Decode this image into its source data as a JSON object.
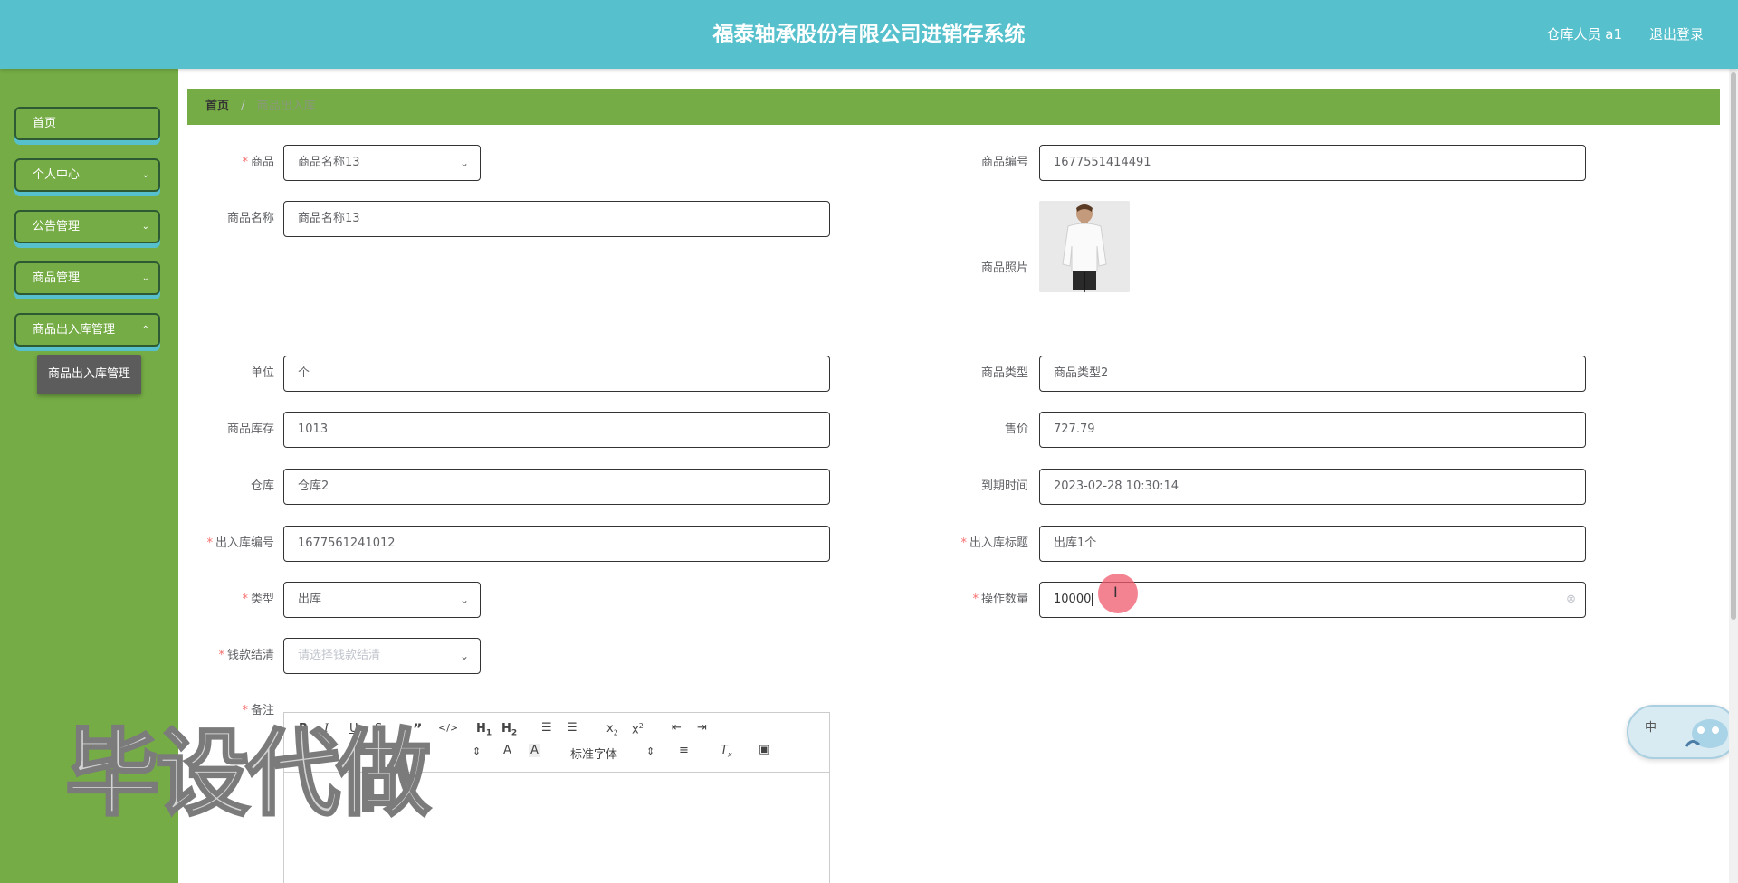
{
  "header": {
    "title": "福泰轴承股份有限公司进销存系统",
    "user": "仓库人员 a1",
    "logout": "退出登录"
  },
  "sidebar": {
    "items": [
      {
        "label": "首页"
      },
      {
        "label": "个人中心",
        "expandable": true
      },
      {
        "label": "公告管理",
        "expandable": true
      },
      {
        "label": "商品管理",
        "expandable": true
      },
      {
        "label": "商品出入库管理",
        "expandable": true
      }
    ],
    "submenu": "商品出入库管理"
  },
  "breadcrumb": {
    "home": "首页",
    "separator": "/",
    "current": "商品出入库"
  },
  "form": {
    "product": {
      "label": "商品",
      "required": true,
      "value": "商品名称13"
    },
    "product_code": {
      "label": "商品编号",
      "value": "1677551414491"
    },
    "product_name": {
      "label": "商品名称",
      "value": "商品名称13"
    },
    "product_photo": {
      "label": "商品照片"
    },
    "unit": {
      "label": "单位",
      "value": "个"
    },
    "product_type": {
      "label": "商品类型",
      "value": "商品类型2"
    },
    "stock": {
      "label": "商品库存",
      "value": "1013"
    },
    "price": {
      "label": "售价",
      "value": "727.79"
    },
    "warehouse": {
      "label": "仓库",
      "value": "仓库2"
    },
    "expire_time": {
      "label": "到期时间",
      "value": "2023-02-28 10:30:14"
    },
    "io_number": {
      "label": "出入库编号",
      "required": true,
      "value": "1677561241012"
    },
    "io_title": {
      "label": "出入库标题",
      "required": true,
      "value": "出库1个"
    },
    "type": {
      "label": "类型",
      "required": true,
      "value": "出库"
    },
    "quantity": {
      "label": "操作数量",
      "required": true,
      "value": "10000"
    },
    "payment": {
      "label": "钱款结清",
      "required": true,
      "placeholder": "请选择钱款结清"
    },
    "remark": {
      "label": "备注",
      "required": true
    }
  },
  "editor": {
    "font_family": "标准字体",
    "tools": [
      "bold-icon",
      "italic-icon",
      "underline-icon",
      "strike-icon",
      "blockquote-icon",
      "code-icon",
      "h1-icon",
      "h2-icon",
      "ordered-list-icon",
      "bullet-list-icon",
      "subscript-icon",
      "superscript-icon",
      "outdent-icon",
      "indent-icon",
      "font-color-icon",
      "background-color-icon",
      "align-icon",
      "clear-format-icon",
      "image-icon"
    ]
  },
  "ime": {
    "label": "中"
  },
  "watermark": "毕设代做",
  "colors": {
    "header": "#56c0cc",
    "sidebar": "#75ac45",
    "breadcrumb": "#75ac45",
    "required": "#f56c6c",
    "cursor": "#f05a6e"
  }
}
